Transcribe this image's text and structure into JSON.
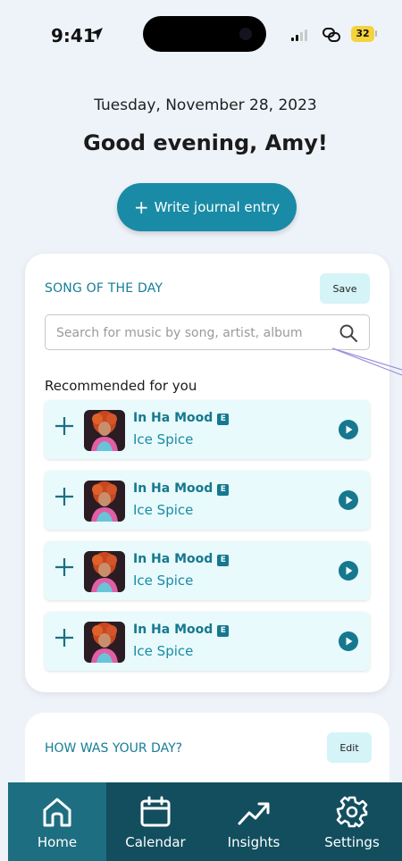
{
  "status": {
    "time": "9:41",
    "battery": "32"
  },
  "header": {
    "date": "Tuesday, November 28, 2023",
    "greeting": "Good evening, Amy!",
    "write_button": "Write journal entry"
  },
  "song_card": {
    "title": "SONG OF THE DAY",
    "save_label": "Save",
    "search_placeholder": "Search for music by song, artist, album",
    "recommended_label": "Recommended for you",
    "songs": [
      {
        "title": "In Ha Mood",
        "explicit": "E",
        "artist": "Ice Spice"
      },
      {
        "title": "In Ha Mood",
        "explicit": "E",
        "artist": "Ice Spice"
      },
      {
        "title": "In Ha Mood",
        "explicit": "E",
        "artist": "Ice Spice"
      },
      {
        "title": "In Ha Mood",
        "explicit": "E",
        "artist": "Ice Spice"
      }
    ]
  },
  "day_card": {
    "title": "HOW WAS YOUR DAY?",
    "edit_label": "Edit"
  },
  "tabs": [
    {
      "label": "Home",
      "icon": "home-icon",
      "active": true
    },
    {
      "label": "Calendar",
      "icon": "calendar-icon",
      "active": false
    },
    {
      "label": "Insights",
      "icon": "trending-up-icon",
      "active": false
    },
    {
      "label": "Settings",
      "icon": "gear-icon",
      "active": false
    }
  ],
  "colors": {
    "accent": "#1a8ba6",
    "tab_bar": "#124e5e",
    "tab_active": "#1d6e80",
    "background": "#eef3f9",
    "row_bg": "#e8fafb"
  }
}
